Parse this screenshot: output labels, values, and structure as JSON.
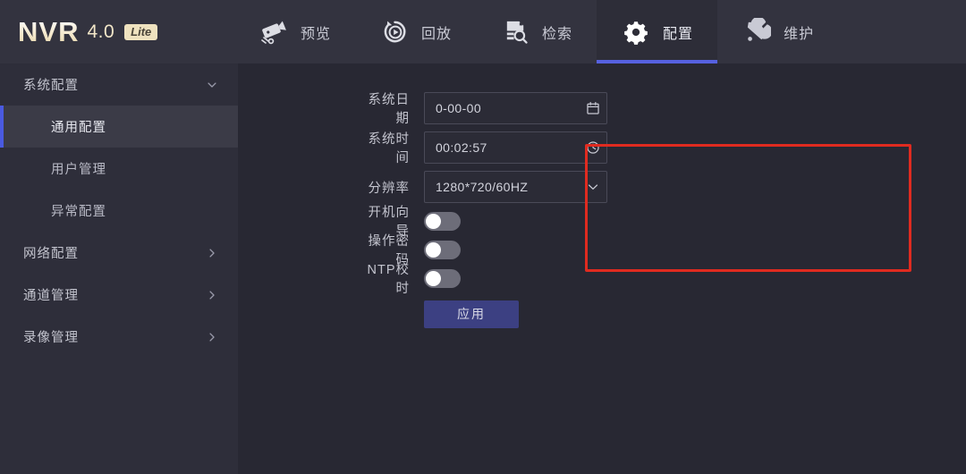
{
  "brand": {
    "name": "NVR",
    "version": "4.0",
    "edition": "Lite"
  },
  "nav": {
    "items": [
      {
        "label": "预览",
        "icon": "camera-icon",
        "active": false
      },
      {
        "label": "回放",
        "icon": "playback-icon",
        "active": false
      },
      {
        "label": "检索",
        "icon": "search-document-icon",
        "active": false
      },
      {
        "label": "配置",
        "icon": "gear-icon",
        "active": true
      },
      {
        "label": "维护",
        "icon": "tools-icon",
        "active": false
      }
    ]
  },
  "sidebar": {
    "items": [
      {
        "label": "系统配置",
        "type": "group",
        "expanded": true,
        "icon": "chevron-down-icon"
      },
      {
        "label": "通用配置",
        "type": "sub",
        "active": true
      },
      {
        "label": "用户管理",
        "type": "sub",
        "active": false
      },
      {
        "label": "异常配置",
        "type": "sub",
        "active": false
      },
      {
        "label": "网络配置",
        "type": "group",
        "expanded": false,
        "icon": "chevron-right-icon"
      },
      {
        "label": "通道管理",
        "type": "group",
        "expanded": false,
        "icon": "chevron-right-icon"
      },
      {
        "label": "录像管理",
        "type": "group",
        "expanded": false,
        "icon": "chevron-right-icon"
      }
    ]
  },
  "form": {
    "date": {
      "label": "系统日期",
      "value": "0-00-00",
      "icon": "calendar-icon"
    },
    "time": {
      "label": "系统时间",
      "value": "00:02:57",
      "icon": "clock-icon"
    },
    "resolution": {
      "label": "分辨率",
      "value": "1280*720/60HZ",
      "icon": "chevron-down-icon",
      "options": [
        "1280*720/60HZ"
      ]
    },
    "toggles": [
      {
        "label": "开机向导",
        "on": false
      },
      {
        "label": "操作密码",
        "on": false
      },
      {
        "label": "NTP校时",
        "on": false
      }
    ],
    "apply_label": "应用"
  },
  "annotation": {
    "highlight_color": "#e02b20"
  },
  "colors": {
    "topbar_bg": "#33333f",
    "sidebar_bg": "#2e2e3a",
    "main_bg": "#282833",
    "accent_blue": "#5661e0",
    "apply_bg": "#3c4082",
    "brand_gold": "#efe2bf"
  }
}
